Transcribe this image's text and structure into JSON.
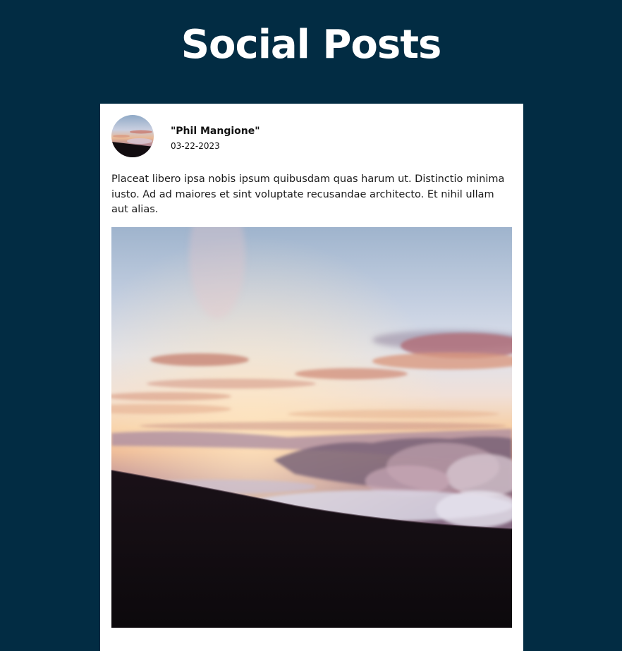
{
  "page": {
    "title": "Social Posts",
    "background_color": "#022c43"
  },
  "post": {
    "author": "\"Phil Mangione\"",
    "date": "03-22-2023",
    "body": "Placeat libero ipsa nobis ipsum quibusdam quas harum ut. Distinctio minima iusto. Ad ad maiores et sint voluptate recusandae architecto. Et nihil ullam aut alias.",
    "image_subject": "sunset above clouds from mountain slope",
    "card_color": "#ffffff"
  }
}
